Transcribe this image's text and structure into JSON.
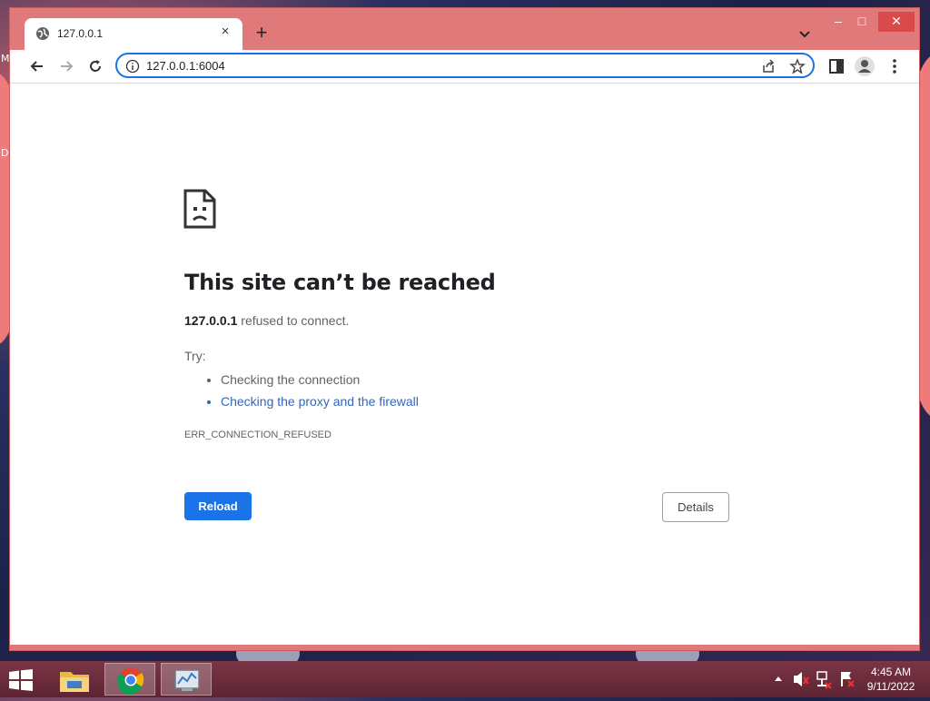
{
  "window": {
    "tab_title": "127.0.0.1",
    "new_tab_symbol": "+",
    "close_symbol": "×",
    "controls": {
      "minimize": "‒",
      "maximize": "□",
      "close": "✕"
    }
  },
  "omnibox": {
    "value": "127.0.0.1:6004"
  },
  "error": {
    "title": "This site can’t be reached",
    "host": "127.0.0.1",
    "desc_rest": " refused to connect.",
    "try_label": "Try:",
    "suggestions": [
      "Checking the connection",
      "Checking the proxy and the firewall"
    ],
    "code": "ERR_CONNECTION_REFUSED",
    "reload_label": "Reload",
    "details_label": "Details"
  },
  "taskbar": {
    "time": "4:45 AM",
    "date": "9/11/2022",
    "items": [
      "file-explorer-icon",
      "chrome-icon",
      "system-monitor-icon"
    ]
  },
  "colors": {
    "accent": "#1a73e8",
    "frame": "#e07a7a",
    "link": "#3367b5",
    "taskbar": "#6b2b3b"
  },
  "desktop": {
    "edge_letters": [
      "M",
      "D"
    ]
  }
}
